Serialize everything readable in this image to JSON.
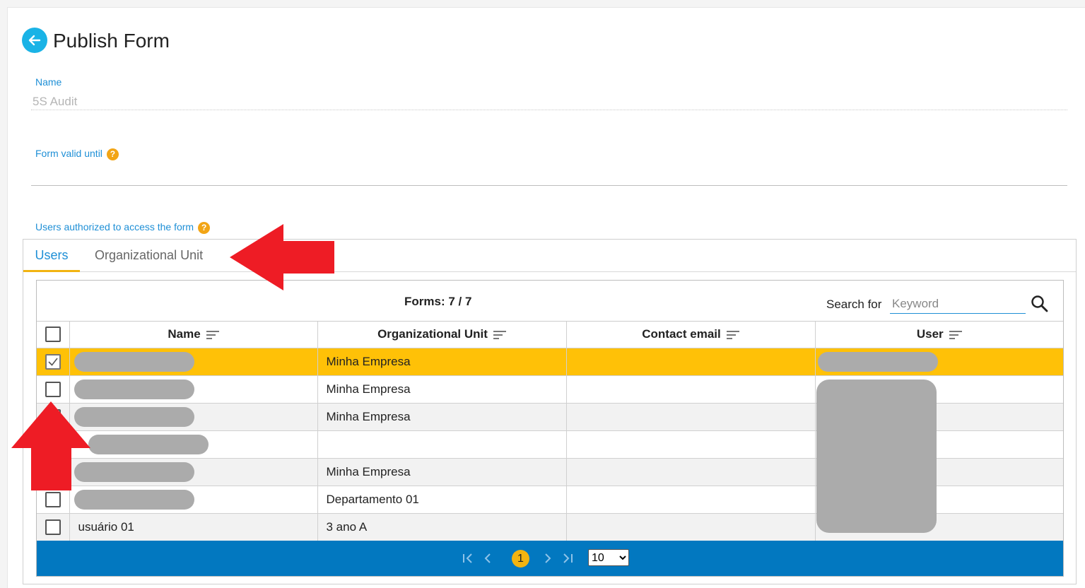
{
  "header": {
    "title": "Publish Form",
    "back_icon": "arrow-left-icon"
  },
  "fields": {
    "name_label": "Name",
    "name_value": "5S Audit",
    "valid_until_label": "Form valid until",
    "users_label": "Users authorized to access the form"
  },
  "tabs": [
    {
      "label": "Users",
      "active": true
    },
    {
      "label": "Organizational Unit",
      "active": false
    }
  ],
  "grid": {
    "forms_count": "Forms: 7 / 7",
    "search_label": "Search for",
    "search_placeholder": "Keyword",
    "columns": [
      "Name",
      "Organizational Unit",
      "Contact email",
      "User"
    ],
    "rows": [
      {
        "name": "",
        "org_unit": "Minha Empresa",
        "email": "",
        "user": "",
        "checked": true
      },
      {
        "name": "",
        "org_unit": "Minha Empresa",
        "email": "",
        "user": "",
        "checked": false
      },
      {
        "name": "",
        "org_unit": "Minha Empresa",
        "email": "",
        "user": "",
        "checked": false
      },
      {
        "name": "",
        "org_unit": "",
        "email": "",
        "user": "",
        "checked": false
      },
      {
        "name": "",
        "org_unit": "Minha Empresa",
        "email": "",
        "user": "",
        "checked": false
      },
      {
        "name": "",
        "org_unit": "Departamento 01",
        "email": "",
        "user": "",
        "checked": false
      },
      {
        "name": "usuário 01",
        "org_unit": "3 ano A",
        "email": "",
        "user": "",
        "checked": false
      }
    ]
  },
  "pagination": {
    "current_page": "1",
    "page_size": "10",
    "page_size_options": [
      "10"
    ]
  },
  "colors": {
    "accent": "#1e8fd6",
    "selected_row": "#ffc107",
    "pager_bg": "#0278c0",
    "annotation": "#ee1c25"
  }
}
